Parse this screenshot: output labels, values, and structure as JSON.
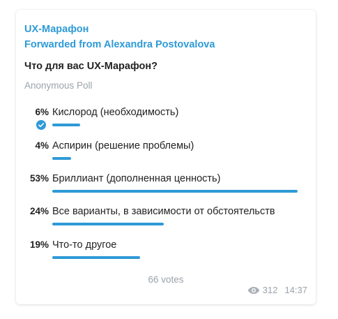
{
  "message": {
    "channel_name": "UX-Марафон",
    "forwarded_from": "Forwarded from Alexandra Postovalova",
    "poll": {
      "question": "Что для вас UX-Марафон?",
      "type": "Anonymous Poll",
      "options": [
        {
          "percent": "6%",
          "text": "Кислород (необходимость)",
          "share": 0.06,
          "selected": true
        },
        {
          "percent": "4%",
          "text": "Аспирин (решение проблемы)",
          "share": 0.04,
          "selected": false
        },
        {
          "percent": "53%",
          "text": "Бриллиант (дополненная ценность)",
          "share": 0.53,
          "selected": false
        },
        {
          "percent": "24%",
          "text": "Все варианты, в зависимости от обстоятельств",
          "share": 0.24,
          "selected": false
        },
        {
          "percent": "19%",
          "text": "Что-то другое",
          "share": 0.19,
          "selected": false
        }
      ],
      "votes": "66 votes"
    },
    "views": "312",
    "time": "14:37"
  },
  "colors": {
    "accent": "#2e9ad6",
    "text": "#222222",
    "muted": "#9aa3ab"
  },
  "icons": {
    "selected_check": "check-circle-icon",
    "views": "eye-icon"
  }
}
